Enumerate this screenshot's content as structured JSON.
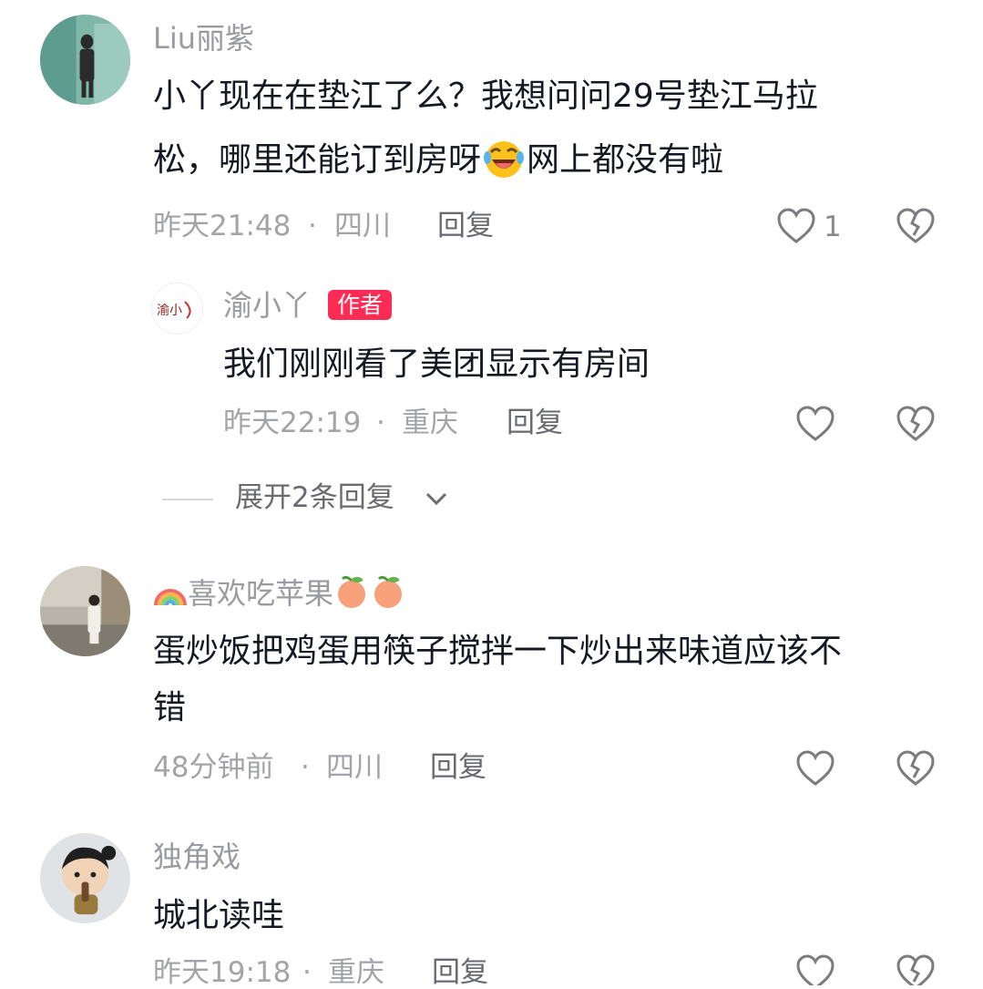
{
  "comments": [
    {
      "username": "Liu丽紫",
      "text_line1": "小丫现在在垫江了么？我想问问29号垫江马拉",
      "text_line2a": "松，哪里还能订到房呀",
      "text_line2b": "网上都没有啦",
      "emoji": "laughing-with-tears-emoji",
      "time": "昨天21:48",
      "separator": "·",
      "location": "四川",
      "reply_label": "回复",
      "like_count": "1",
      "sub_reply": {
        "username": "渝小丫",
        "badge": "作者",
        "text": "我们刚刚看了美团显示有房间",
        "time": "昨天22:19",
        "separator": "·",
        "location": "重庆",
        "reply_label": "回复"
      },
      "expand_label": "展开2条回复"
    },
    {
      "username": "喜欢吃苹果",
      "username_prefix_emoji": "rainbow-emoji",
      "username_suffix_emoji": "peach-emoji",
      "text_line1": "蛋炒饭把鸡蛋用筷子搅拌一下炒出来味道应该不",
      "text_line2": "错",
      "time": "48分钟前",
      "separator": "·",
      "location": "四川",
      "reply_label": "回复"
    },
    {
      "username": "独角戏",
      "text_line1": "城北读哇",
      "time": "昨天19:18",
      "separator": "·",
      "location": "重庆",
      "reply_label": "回复"
    }
  ],
  "colors": {
    "author_badge": "#fe2c55",
    "meta_text": "#a3a4a8",
    "body_text": "#161823"
  },
  "icons": [
    "heart-outline-icon",
    "dislike-broken-heart-icon",
    "chevron-down-icon"
  ]
}
